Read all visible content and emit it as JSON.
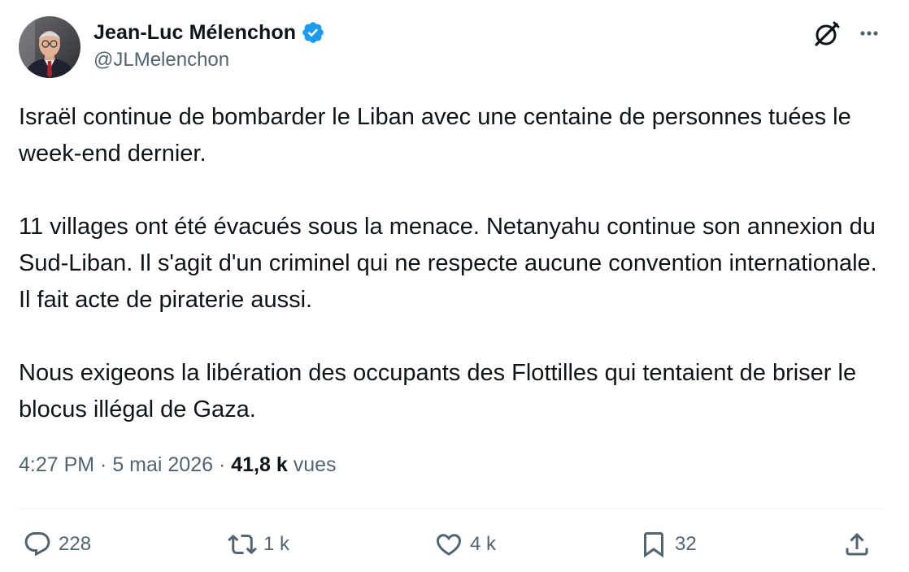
{
  "author": {
    "name": "Jean-Luc Mélenchon",
    "handle": "@JLMelenchon",
    "verified": true,
    "verified_color": "#1d9bf0"
  },
  "tweet": {
    "paragraphs": [
      "Israël continue de bombarder le Liban avec une centaine de personnes tuées le week-end dernier.",
      "11 villages ont été évacués sous la menace. Netanyahu continue son annexion du Sud-Liban. Il s'agit d'un criminel qui ne respecte aucune convention internationale. Il fait acte de piraterie aussi.",
      "Nous exigeons la libération des occupants des Flottilles qui tentaient de briser le blocus illégal de Gaza."
    ]
  },
  "meta": {
    "time": "4:27 PM",
    "separator": " · ",
    "date": "5 mai 2026",
    "views_count": "41,8 k",
    "views_label": "vues"
  },
  "actions": {
    "reply_count": "228",
    "retweet_count": "1 k",
    "like_count": "4 k",
    "bookmark_count": "32"
  },
  "icons": {
    "avatar": "profile-photo",
    "verified": "verified-badge-icon",
    "grok": "grok-icon",
    "more": "more-options-icon",
    "reply": "reply-icon",
    "retweet": "retweet-icon",
    "like": "heart-icon",
    "bookmark": "bookmark-icon",
    "share": "share-icon"
  },
  "colors": {
    "text_primary": "#0f1419",
    "text_secondary": "#536471",
    "divider": "#eff3f4"
  }
}
